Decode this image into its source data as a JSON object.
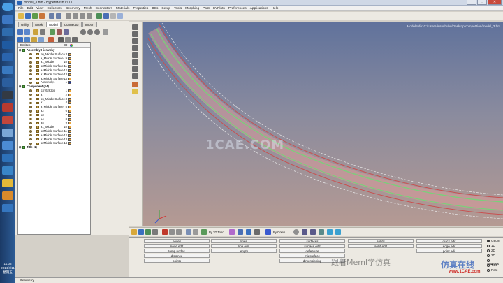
{
  "window": {
    "title": "model_3.hm - HyperMesh v11.0",
    "minimize": "_",
    "maximize": "□",
    "close": "✕"
  },
  "menu": [
    "File",
    "Edit",
    "View",
    "Collectors",
    "Geometry",
    "Mesh",
    "Connectors",
    "Materials",
    "Properties",
    "BCs",
    "Setup",
    "Tools",
    "Morphing",
    "Post",
    "XYPlots",
    "Preferences",
    "Applications",
    "Help"
  ],
  "tabs": [
    "Utility",
    "Mask",
    "Model",
    "Connector",
    "Import"
  ],
  "browser": {
    "col_entities": "Entities",
    "col_id": "ID",
    "rows": [
      {
        "label": "Assembly Hierarchy",
        "id": "",
        "indent": 0,
        "group": true,
        "color": ""
      },
      {
        "label": "ou_Middle Surface",
        "id": "3",
        "indent": 2,
        "group": false,
        "color": "#e8a33a"
      },
      {
        "label": "a_Middle Surface",
        "id": "9",
        "indent": 2,
        "group": false,
        "color": "#e8a33a"
      },
      {
        "label": "a1_Middle",
        "id": "10",
        "indent": 2,
        "group": false,
        "color": "#e8a33a"
      },
      {
        "label": "a3Middle Surface",
        "id": "11",
        "indent": 2,
        "group": false,
        "color": "#e8a33a"
      },
      {
        "label": "a4Middle Surface",
        "id": "12",
        "indent": 2,
        "group": false,
        "color": "#e8a33a"
      },
      {
        "label": "a1Middle Surface",
        "id": "13",
        "indent": 2,
        "group": false,
        "color": "#e8a33a"
      },
      {
        "label": "a2Middle Surface",
        "id": "14",
        "indent": 2,
        "group": false,
        "color": "#e8a33a"
      },
      {
        "label": "Assembly1",
        "id": "1",
        "indent": 2,
        "group": false,
        "color": "#1a2fa8"
      },
      {
        "label": "Component (14)",
        "id": "",
        "indent": 0,
        "group": true,
        "color": ""
      },
      {
        "label": "bzrr6262pp",
        "id": "1",
        "indent": 2,
        "group": false,
        "color": "#e8a33a"
      },
      {
        "label": "a",
        "id": "2",
        "indent": 2,
        "group": false,
        "color": "#e8a33a"
      },
      {
        "label": "ou_Middle Surface",
        "id": "3",
        "indent": 2,
        "group": false,
        "color": "#e8a33a"
      },
      {
        "label": "a1",
        "id": "4",
        "indent": 2,
        "group": false,
        "color": "#e8a33a"
      },
      {
        "label": "a_Middle Surface",
        "id": "5",
        "indent": 2,
        "group": false,
        "color": "#e8a33a"
      },
      {
        "label": "a2",
        "id": "6",
        "indent": 2,
        "group": false,
        "color": "#e8a33a"
      },
      {
        "label": "a3",
        "id": "7",
        "indent": 2,
        "group": false,
        "color": "#e8a33a"
      },
      {
        "label": "a4",
        "id": "8",
        "indent": 2,
        "group": false,
        "color": "#e8a33a"
      },
      {
        "label": "a5",
        "id": "9",
        "indent": 2,
        "group": false,
        "color": "#e8a33a"
      },
      {
        "label": "a1_Middle",
        "id": "10",
        "indent": 2,
        "group": false,
        "color": "#e8a33a"
      },
      {
        "label": "a3Middle Surface",
        "id": "11",
        "indent": 2,
        "group": false,
        "color": "#e8a33a"
      },
      {
        "label": "a4Middle Surface",
        "id": "12",
        "indent": 2,
        "group": false,
        "color": "#e8a33a"
      },
      {
        "label": "a1Middle Surface",
        "id": "13",
        "indent": 2,
        "group": false,
        "color": "#e8a33a"
      },
      {
        "label": "a2Middle Surface",
        "id": "14",
        "indent": 2,
        "group": false,
        "color": "#e8a33a"
      },
      {
        "label": "Title (1)",
        "id": "",
        "indent": 0,
        "group": true,
        "color": ""
      }
    ]
  },
  "graphics": {
    "model_info": "Model Info: C:/Users/lesushuhu/Desktop/competition/model_3.hm",
    "watermark": "1CAE.COM"
  },
  "bottom_tools": {
    "by_2d_topo": "By 2D Topo",
    "by_comp": "By Comp"
  },
  "commands": {
    "col1": [
      "nodes",
      "node edit",
      "temp nodes",
      "distance",
      "points"
    ],
    "col2": [
      "lines",
      "line edit",
      "length"
    ],
    "col3": [
      "surfaces",
      "surface edit",
      "defeature",
      "midsurface",
      "dimensioning"
    ],
    "col4": [
      "solids",
      "solid edit",
      "",
      "",
      ""
    ],
    "col5": [
      "quick edit",
      "edge edit",
      "point edit",
      "",
      ""
    ]
  },
  "radios": [
    "Geom",
    "1D",
    "2D",
    "3D",
    "Analysis",
    "Tool",
    "Post"
  ],
  "brand": {
    "wechat": "跟着Meml学仿真",
    "site_cn": "仿真在线",
    "site_url": "www.1CAE.com"
  },
  "status": "Geometry",
  "clock": {
    "time": "11:08",
    "date": "2014/4/11",
    "day": "星期五"
  }
}
